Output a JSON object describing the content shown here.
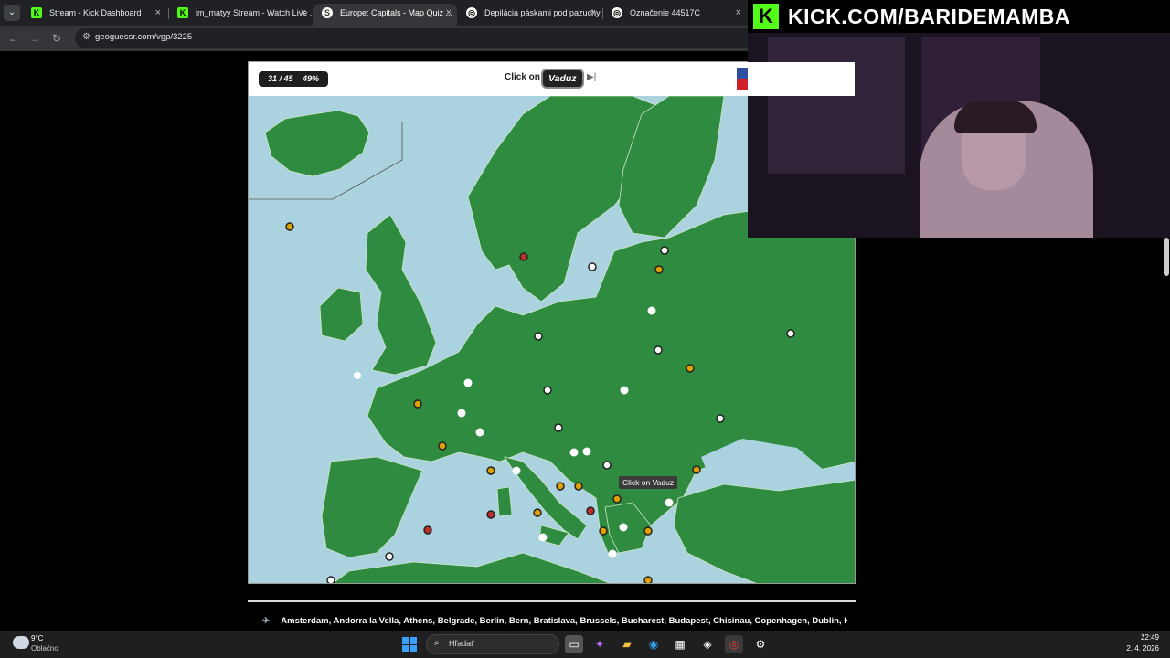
{
  "browser": {
    "tabs": [
      {
        "title": "Stream - Kick Dashboard",
        "favicon": "kick-icon",
        "active": false
      },
      {
        "title": "im_matyy Stream - Watch Live ...",
        "favicon": "kick-icon",
        "active": false
      },
      {
        "title": "Europe: Capitals - Map Quiz ...",
        "favicon": "seterra-icon",
        "active": true
      },
      {
        "title": "Depilácia páskami pod pazuchy",
        "favicon": "chatgpt-icon",
        "active": false
      },
      {
        "title": "Označenie 44517C",
        "favicon": "chatgpt-icon",
        "active": false
      }
    ],
    "close_glyph": "×",
    "address": "geoguessr.com/vgp/3225"
  },
  "quiz": {
    "progress": "31 / 45",
    "percent": "49%",
    "prompt_label": "Click on",
    "target": "Vaduz",
    "skip_glyph": "▶|",
    "tooltip": "Click on Vaduz"
  },
  "capitals_list": "Amsterdam, Andorra la Vella, Athens, Belgrade, Berlin, Bern, Bratislava, Brussels, Bucharest, Budapest, Chisinau, Copenhagen, Dublin, Helsinki,",
  "webcam": {
    "banner": "KICK.COM/BARIDEMAMBA",
    "logo_letter": "K"
  },
  "taskbar": {
    "weather_temp": "9°C",
    "weather_desc": "Oblačno",
    "search_placeholder": "Hľadať",
    "time": "22:49",
    "date": "2. 4. 2026"
  },
  "map_colors": {
    "land": "#2e8b3f",
    "water": "#aad3df",
    "dot_white": "#ffffff",
    "dot_orange": "#e0a000",
    "dot_red": "#c0302a"
  }
}
